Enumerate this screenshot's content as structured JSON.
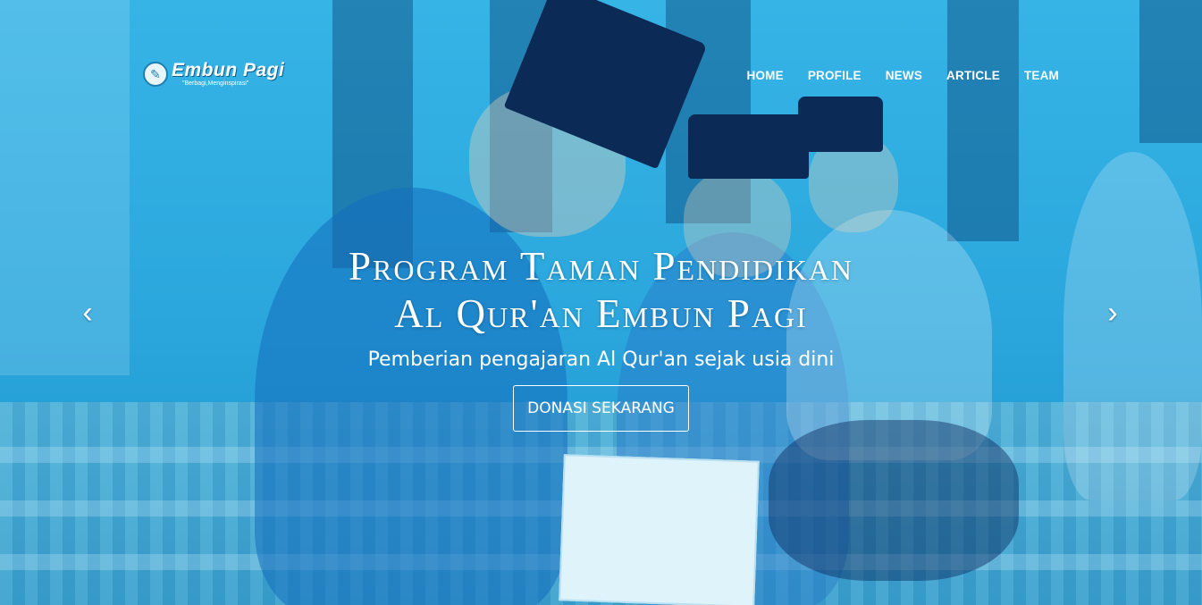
{
  "brand": {
    "name": "Embun Pagi",
    "tagline": "\"Berbagi,Menginspirasi\""
  },
  "nav": {
    "items": [
      {
        "label": "HOME"
      },
      {
        "label": "PROFILE"
      },
      {
        "label": "NEWS"
      },
      {
        "label": "ARTICLE"
      },
      {
        "label": "TEAM"
      }
    ]
  },
  "hero": {
    "title_line1": "Program Taman Pendidikan",
    "title_line2": "Al Qur'an Embun Pagi",
    "subtitle": "Pemberian pengajaran Al Qur'an sejak usia dini",
    "cta_label": "DONASI SEKARANG",
    "prev_icon": "‹",
    "next_icon": "›"
  },
  "colors": {
    "overlay": "#2aa8dc",
    "text": "#ffffff"
  }
}
